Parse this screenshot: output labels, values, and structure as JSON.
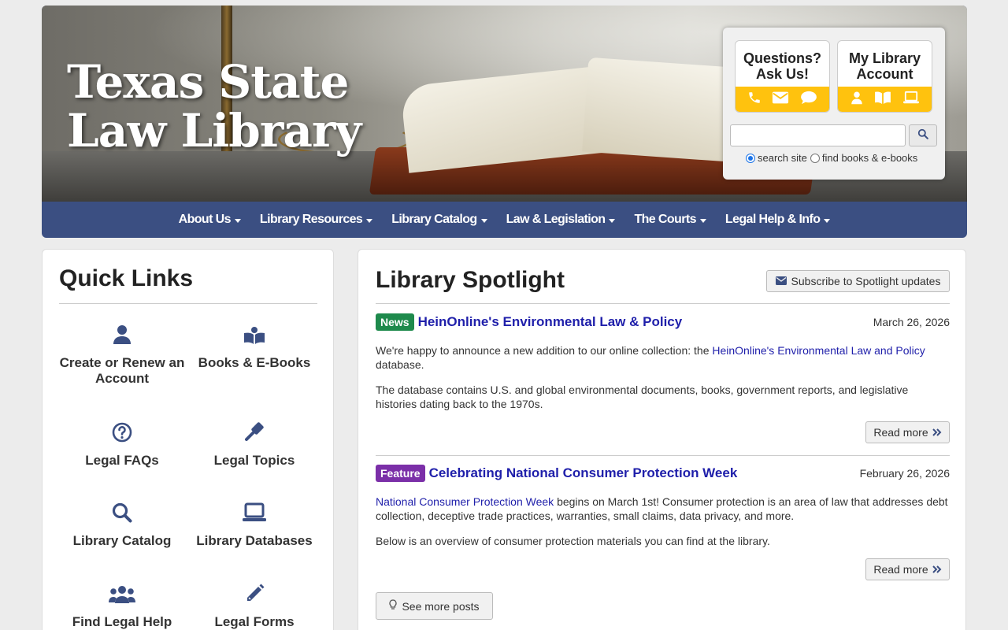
{
  "header": {
    "title_line1": "Texas State",
    "title_line2": "Law Library",
    "questions_card": {
      "title_line1": "Questions?",
      "title_line2": "Ask Us!",
      "icons": [
        "phone-icon",
        "envelope-icon",
        "chat-icon"
      ]
    },
    "account_card": {
      "title_line1": "My Library",
      "title_line2": "Account",
      "icons": [
        "user-icon",
        "book-icon",
        "laptop-icon"
      ]
    },
    "search": {
      "value": "",
      "placeholder": "",
      "radio_site": "search site",
      "radio_books": "find books & e-books",
      "selected": "search site"
    },
    "accent_color": "#ffc20e",
    "nav_color": "#3b4f82"
  },
  "nav": {
    "items": [
      {
        "label": "About Us"
      },
      {
        "label": "Library Resources"
      },
      {
        "label": "Library Catalog"
      },
      {
        "label": "Law & Legislation"
      },
      {
        "label": "The Courts"
      },
      {
        "label": "Legal Help & Info"
      }
    ]
  },
  "quick_links": {
    "title": "Quick Links",
    "items": [
      {
        "label": "Create or Renew an Account",
        "icon": "user-icon"
      },
      {
        "label": "Books & E-Books",
        "icon": "open-book-icon"
      },
      {
        "label": "Legal FAQs",
        "icon": "question-circle-icon"
      },
      {
        "label": "Legal Topics",
        "icon": "gavel-icon"
      },
      {
        "label": "Library Catalog",
        "icon": "search-icon"
      },
      {
        "label": "Library Databases",
        "icon": "laptop-icon"
      },
      {
        "label": "Find Legal Help",
        "icon": "users-icon"
      },
      {
        "label": "Legal Forms",
        "icon": "pencil-icon"
      }
    ]
  },
  "spotlight": {
    "title": "Library Spotlight",
    "subscribe_label": "Subscribe to Spotlight updates",
    "posts": [
      {
        "badge": "News",
        "badge_color": "#1e8a4c",
        "title": "HeinOnline's Environmental Law & Policy",
        "date": "March 26, 2026",
        "p1_before": "We're happy to announce a new addition to our online collection: the ",
        "p1_link": "HeinOnline's Environmental Law and Policy",
        "p1_after": " database.",
        "p2": "The database contains U.S. and global environmental documents, books, government reports, and legislative histories dating back to the 1970s.",
        "read_more": "Read more"
      },
      {
        "badge": "Feature",
        "badge_color": "#7b2fa8",
        "title": "Celebrating National Consumer Protection Week",
        "date": "February 26, 2026",
        "p1_link": "National Consumer Protection Week",
        "p1_after": " begins on March 1st! Consumer protection is an area of law that addresses debt collection, deceptive trade practices, warranties, small claims, data privacy, and more.",
        "p2": "Below is an overview of consumer protection materials you can find at the library.",
        "read_more": "Read more"
      }
    ],
    "see_more": "See more posts"
  }
}
